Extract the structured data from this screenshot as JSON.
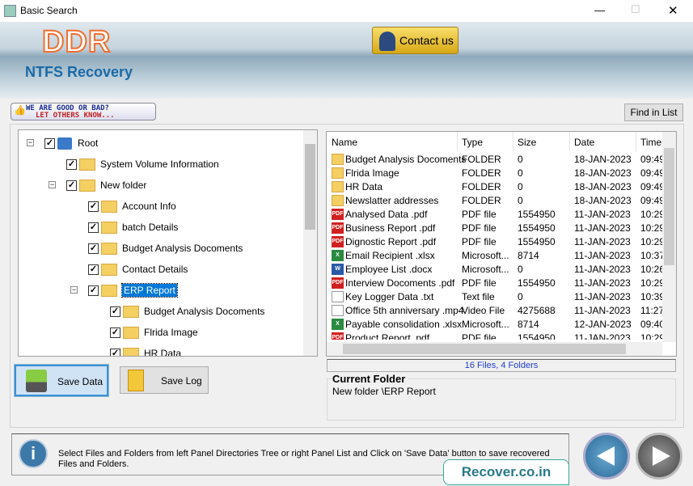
{
  "window": {
    "title": "Basic Search",
    "minimize": "—",
    "maximize": "☐",
    "close": "✕"
  },
  "banner": {
    "logo": "DDR",
    "product": "NTFS Recovery",
    "contact_label": "Contact us"
  },
  "toolbar": {
    "feedback_line1": "WE ARE GOOD OR BAD?",
    "feedback_line2": "LET OTHERS KNOW...",
    "find_label": "Find in List"
  },
  "tree": [
    {
      "label": "Root",
      "level": 0,
      "expander": "−",
      "checked": true,
      "icon": "computer-icon"
    },
    {
      "label": "System Volume Information",
      "level": 1,
      "checked": true
    },
    {
      "label": "New folder",
      "level": 1,
      "expander": "−",
      "checked": true
    },
    {
      "label": "Account Info",
      "level": 2,
      "checked": true
    },
    {
      "label": "batch Details",
      "level": 2,
      "checked": true
    },
    {
      "label": "Budget Analysis Docoments",
      "level": 2,
      "checked": true
    },
    {
      "label": "Contact Details",
      "level": 2,
      "checked": true
    },
    {
      "label": "ERP Report",
      "level": 2,
      "expander": "−",
      "checked": true,
      "selected": true
    },
    {
      "label": "Budget Analysis Docoments",
      "level": 3,
      "checked": true
    },
    {
      "label": "Flrida Image",
      "level": 3,
      "checked": true
    },
    {
      "label": "HR Data",
      "level": 3,
      "checked": true
    }
  ],
  "list": {
    "columns": [
      "Name",
      "Type",
      "Size",
      "Date",
      "Time"
    ],
    "rows": [
      {
        "icon": "folder",
        "name": "Budget Analysis Docoments",
        "type": "FOLDER",
        "size": "0",
        "date": "18-JAN-2023",
        "time": "09:49"
      },
      {
        "icon": "folder",
        "name": "Flrida Image",
        "type": "FOLDER",
        "size": "0",
        "date": "18-JAN-2023",
        "time": "09:49"
      },
      {
        "icon": "folder",
        "name": "HR Data",
        "type": "FOLDER",
        "size": "0",
        "date": "18-JAN-2023",
        "time": "09:49"
      },
      {
        "icon": "folder",
        "name": "Newslatter addresses",
        "type": "FOLDER",
        "size": "0",
        "date": "18-JAN-2023",
        "time": "09:49"
      },
      {
        "icon": "pdf",
        "name": "Analysed Data .pdf",
        "type": "PDF file",
        "size": "1554950",
        "date": "11-JAN-2023",
        "time": "10:29"
      },
      {
        "icon": "pdf",
        "name": "Business Report .pdf",
        "type": "PDF file",
        "size": "1554950",
        "date": "11-JAN-2023",
        "time": "10:29"
      },
      {
        "icon": "pdf",
        "name": "Dignostic Report .pdf",
        "type": "PDF file",
        "size": "1554950",
        "date": "11-JAN-2023",
        "time": "10:29"
      },
      {
        "icon": "xlsx",
        "name": "Email Recipient .xlsx",
        "type": "Microsoft...",
        "size": "8714",
        "date": "11-JAN-2023",
        "time": "10:37"
      },
      {
        "icon": "docx",
        "name": "Employee List .docx",
        "type": "Microsoft...",
        "size": "0",
        "date": "11-JAN-2023",
        "time": "10:26"
      },
      {
        "icon": "pdf",
        "name": "Interview Docoments .pdf",
        "type": "PDF file",
        "size": "1554950",
        "date": "11-JAN-2023",
        "time": "10:29"
      },
      {
        "icon": "txt",
        "name": "Key Logger Data .txt",
        "type": "Text file",
        "size": "0",
        "date": "11-JAN-2023",
        "time": "10:39"
      },
      {
        "icon": "file",
        "name": "Office 5th anniversary .mp4",
        "type": "Video File",
        "size": "4275688",
        "date": "11-JAN-2023",
        "time": "11:27"
      },
      {
        "icon": "xlsx",
        "name": "Payable consolidation .xlsx",
        "type": "Microsoft...",
        "size": "8714",
        "date": "12-JAN-2023",
        "time": "09:40"
      },
      {
        "icon": "pdf",
        "name": "Product Report .pdf",
        "type": "PDF file",
        "size": "1554950",
        "date": "11-JAN-2023",
        "time": "10:29"
      }
    ],
    "status": "16 Files, 4 Folders"
  },
  "current_folder": {
    "title": "Current Folder",
    "path": "New folder \\ERP Report"
  },
  "actions": {
    "save_data": "Save Data",
    "save_log": "Save Log"
  },
  "info": {
    "text": "Select Files and Folders from left Panel Directories Tree or right Panel List and Click on 'Save Data' button to save recovered Files and Folders.",
    "brand": "Recover.co.in"
  },
  "colors": {
    "accent": "#1a6aa8",
    "selected": "#0078d7",
    "status_text": "#1e3fd0"
  }
}
